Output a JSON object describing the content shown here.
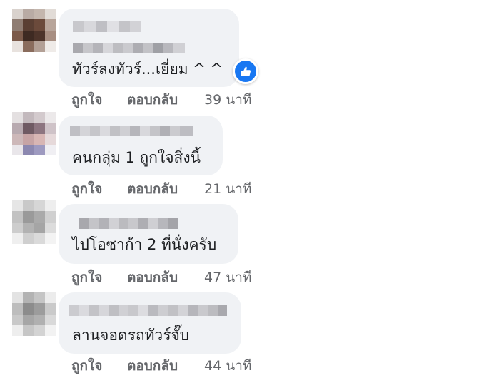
{
  "comments": [
    {
      "text": "ทัวร์ลงทัวร์...เยี่ยม ^ ^",
      "like_label": "ถูกใจ",
      "reply_label": "ตอบกลับ",
      "time": "39 นาที",
      "reaction_icon": "thumbs-up-icon"
    },
    {
      "text": "คนกลุ่ม 1 ถูกใจสิ่งนี้",
      "like_label": "ถูกใจ",
      "reply_label": "ตอบกลับ",
      "time": "21 นาที"
    },
    {
      "text": "ไปโอซาก้า 2 ที่นั่งครับ",
      "like_label": "ถูกใจ",
      "reply_label": "ตอบกลับ",
      "time": "47 นาที"
    },
    {
      "text": "ลานจอดรถทัวร์จั๊บ",
      "like_label": "ถูกใจ",
      "reply_label": "ตอบกลับ",
      "time": "44 นาที"
    }
  ],
  "colors": {
    "bubble_bg": "#f0f2f5",
    "secondary_text": "#65676b",
    "primary_text": "#1c1e21",
    "like_blue": "#1877f2"
  }
}
